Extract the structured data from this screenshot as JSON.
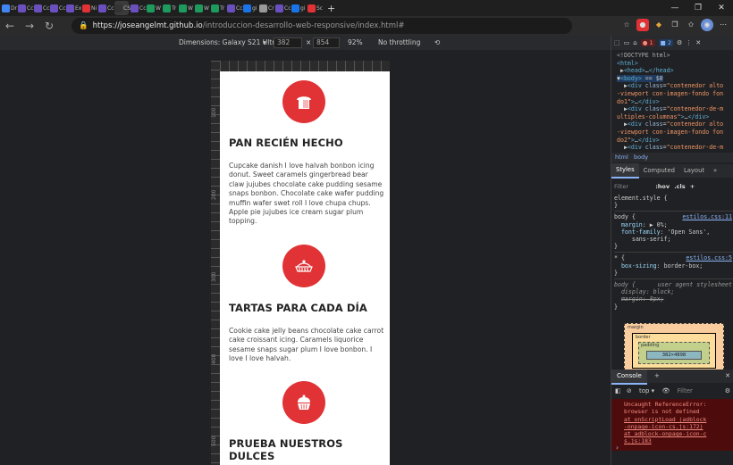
{
  "browser": {
    "tabs": [
      {
        "label": "Dr",
        "color": "#4285f4"
      },
      {
        "label": "Cc",
        "color": "#6a4fbf"
      },
      {
        "label": "Cc",
        "color": "#6a4fbf"
      },
      {
        "label": "Cc",
        "color": "#6a4fbf"
      },
      {
        "label": "Ex",
        "color": "#6a4fbf"
      },
      {
        "label": "Ni",
        "color": "#e13236"
      },
      {
        "label": "Cc",
        "color": "#6a4fbf"
      },
      {
        "label": "CS",
        "color": "#333333"
      },
      {
        "label": "Cc",
        "color": "#6a4fbf"
      },
      {
        "label": "W",
        "color": "#1c9b5c"
      },
      {
        "label": "Tr",
        "color": "#1c9b5c"
      },
      {
        "label": "W",
        "color": "#1c9b5c"
      },
      {
        "label": "W",
        "color": "#1c9b5c"
      },
      {
        "label": "Tr",
        "color": "#1c9b5c"
      },
      {
        "label": "Cc",
        "color": "#6a4fbf"
      },
      {
        "label": "gi",
        "color": "#1a73e8"
      },
      {
        "label": "Cr",
        "color": "#999999"
      },
      {
        "label": "Cc",
        "color": "#6a4fbf"
      },
      {
        "label": "gi",
        "color": "#1a73e8"
      },
      {
        "label": "Sc",
        "color": "#e13236"
      }
    ],
    "url_host": "https://joseangelmt.github.io",
    "url_path": "/introduccion-desarrollo-web-responsive/index.html#"
  },
  "device_toolbar": {
    "dimensions_label": "Dimensions: Galaxy S21 Ultra",
    "width": "382",
    "height": "854",
    "zoom": "92%",
    "throttling": "No throttling"
  },
  "rulers": [
    "100",
    "200",
    "300",
    "400",
    "500"
  ],
  "page": {
    "sections": [
      {
        "title": "PAN RECIÉN HECHO",
        "body": "Cupcake danish I love halvah bonbon icing donut. Sweet caramels gingerbread bear claw jujubes chocolate cake pudding sesame snaps bonbon. Chocolate cake wafer pudding muffin wafer swet roll I love chupa chups. Apple pie jujubes ice cream sugar plum topping.",
        "icon": "bread-icon"
      },
      {
        "title": "TARTAS PARA CADA DÍA",
        "body": "Cookie cake jelly beans chocolate cake carrot cake croissant icing. Caramels liquorice sesame snaps sugar plum I love bonbon. I love I love halvah.",
        "icon": "pie-icon"
      },
      {
        "title": "PRUEBA NUESTROS DULCES",
        "body": "",
        "icon": "cupcake-icon"
      }
    ],
    "accent": "#e13236"
  },
  "devtools": {
    "error_count": "1",
    "issue_count": "2",
    "crumbs": [
      "html",
      "body"
    ],
    "style_tabs": [
      "Styles",
      "Computed",
      "Layout",
      "»"
    ],
    "filter_placeholder": "Filter",
    "hov": ":hov",
    "cls": ".cls",
    "box_content": "382×4898",
    "box_margin": "margin",
    "box_border": "border",
    "box_padding": "padding",
    "console_tab": "Console",
    "console_context": "top",
    "console_filter": "Filter",
    "error_lines": [
      "Uncaught ReferenceError:",
      "browser is not defined",
      "    at onScriptLoad (adblock",
      "-onpage-icon-cs.js:172)",
      "    at adblock-onpage-icon-c",
      "s.js:183"
    ]
  }
}
